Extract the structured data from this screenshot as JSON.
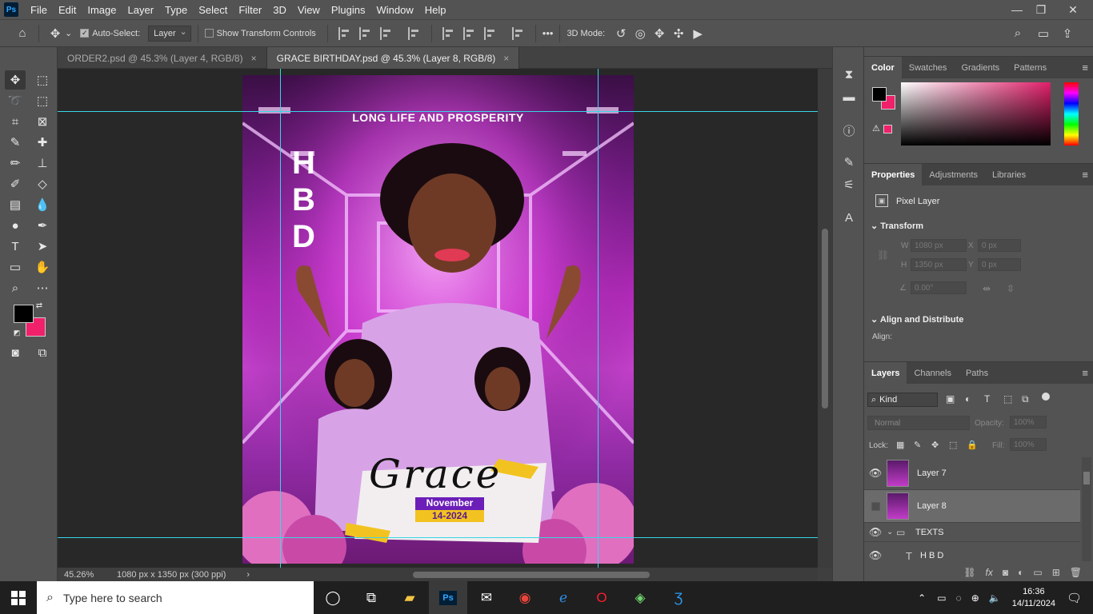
{
  "menubar": {
    "logo": "Ps",
    "items": [
      "File",
      "Edit",
      "Image",
      "Layer",
      "Type",
      "Select",
      "Filter",
      "3D",
      "View",
      "Plugins",
      "Window",
      "Help"
    ],
    "window_controls": [
      "—",
      "❐",
      "✕"
    ]
  },
  "options": {
    "auto_select_label": "Auto-Select:",
    "auto_select_value": "Layer",
    "transform_controls_label": "Show Transform Controls",
    "mode_3d_label": "3D Mode:",
    "more": "•••"
  },
  "doc_tabs": [
    {
      "label": "ORDER2.psd @ 45.3% (Layer 4, RGB/8)",
      "active": false
    },
    {
      "label": "GRACE BIRTHDAY.psd @ 45.3% (Layer 8, RGB/8)",
      "active": true
    }
  ],
  "tab_close": "×",
  "artwork": {
    "headline": "LONG LIFE AND PROSPERITY",
    "hbd_letters": [
      "H",
      "B",
      "D"
    ],
    "name_script": "Grace",
    "month_label": "November",
    "date_label": "14-2024"
  },
  "status": {
    "zoom": "45.26%",
    "doc_info": "1080 px x 1350 px (300 ppi)",
    "arrow": "›"
  },
  "color_panel": {
    "tabs": [
      "Color",
      "Swatches",
      "Gradients",
      "Patterns"
    ],
    "active_tab": "Color",
    "foreground": "#000000",
    "background": "#f0206a"
  },
  "properties": {
    "tabs": [
      "Properties",
      "Adjustments",
      "Libraries"
    ],
    "active_tab": "Properties",
    "layer_type": "Pixel Layer",
    "transform_header": "Transform",
    "w_label": "W",
    "w_value": "1080 px",
    "h_label": "H",
    "h_value": "1350 px",
    "x_label": "X",
    "x_value": "0 px",
    "y_label": "Y",
    "y_value": "0 px",
    "angle_value": "0.00°",
    "align_header": "Align and Distribute",
    "align_label": "Align:"
  },
  "layers_panel": {
    "tabs": [
      "Layers",
      "Channels",
      "Paths"
    ],
    "active_tab": "Layers",
    "filter_label": "Kind",
    "blend_mode": "Normal",
    "opacity_label": "Opacity:",
    "opacity_value": "100%",
    "lock_label": "Lock:",
    "fill_label": "Fill:",
    "fill_value": "100%",
    "layers": [
      {
        "name": "Layer 7",
        "visible": true
      },
      {
        "name": "Layer 8",
        "visible": false,
        "selected": true
      },
      {
        "name": "TEXTS",
        "visible": true,
        "group": true
      },
      {
        "name": "H B D",
        "visible": true,
        "type": "text"
      }
    ],
    "bottom_icons": [
      "link-icon",
      "fx-icon",
      "mask-icon",
      "adjustment-icon",
      "folder-icon",
      "new-layer-icon",
      "trash-icon"
    ]
  },
  "taskbar": {
    "search_placeholder": "Type here to search",
    "time": "16:36",
    "date": "14/11/2024",
    "apps": [
      "cortana-icon",
      "task-view-icon",
      "file-explorer-icon",
      "photoshop-icon",
      "mail-icon",
      "chrome-icon",
      "edge-icon",
      "opera-icon",
      "app-icon",
      "app3-icon"
    ]
  }
}
